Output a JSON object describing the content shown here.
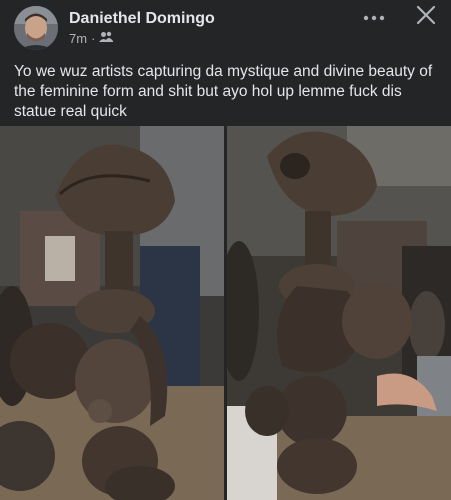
{
  "post": {
    "author": "Daniethel Domingo",
    "time": "7m",
    "separator": "·",
    "audience_icon": "friends-icon",
    "text": "Yo we wuz artists capturing da mystique and divine beauty of the feminine form and shit but ayo hol up lemme fuck dis statue real quick",
    "more_icon": "more-options-icon",
    "close_icon": "close-icon"
  },
  "photos": [
    {
      "id": "photo-left",
      "subject": "carved wooden figure statue"
    },
    {
      "id": "photo-right",
      "subject": "carved wooden figure statue"
    }
  ]
}
